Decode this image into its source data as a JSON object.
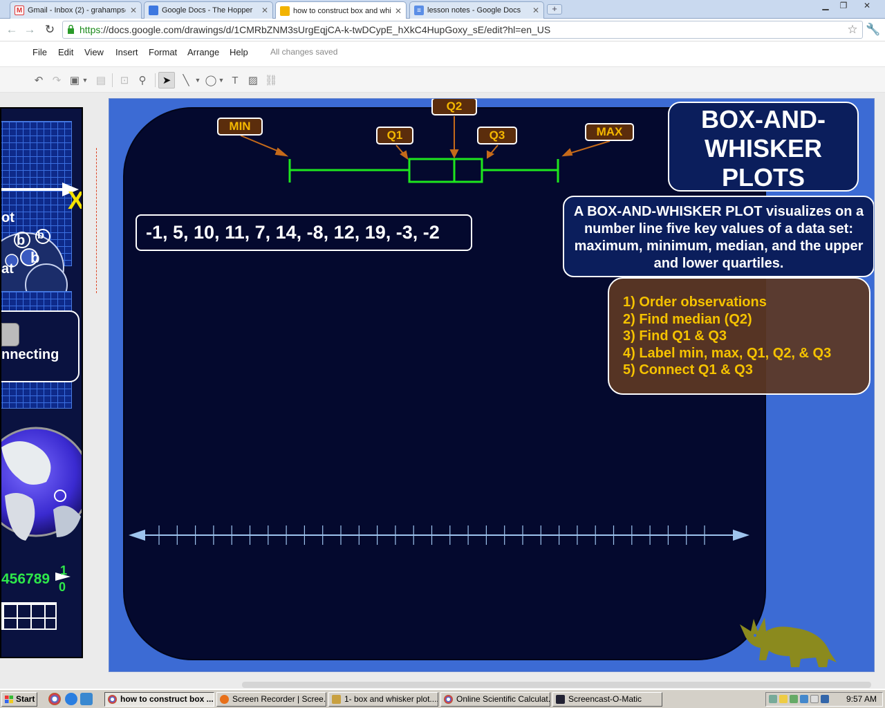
{
  "browser": {
    "tabs": [
      {
        "label": "Gmail - Inbox (2) - grahamps@",
        "favicon": "gmail-icon",
        "active": false
      },
      {
        "label": "Google Docs - The Hopper",
        "favicon": "docs-icon",
        "active": false
      },
      {
        "label": "how to construct box and whis",
        "favicon": "drawings-icon",
        "active": true
      },
      {
        "label": "lesson notes - Google Docs",
        "favicon": "document-icon",
        "active": false
      }
    ],
    "url_scheme": "https",
    "url_rest": "://docs.google.com/drawings/d/1CMRbZNM3sUrgEqjCA-k-twDCypE_hXkC4HupGoxy_sE/edit?hl=en_US"
  },
  "menu": {
    "items": [
      "File",
      "Edit",
      "View",
      "Insert",
      "Format",
      "Arrange",
      "Help"
    ],
    "status": "All changes saved"
  },
  "peek": {
    "x_label": "X",
    "text1": "ot",
    "text2": "at",
    "text3": "e",
    "text4": "nnecting",
    "digits": "456789",
    "digits_tail": "1",
    "digits_tail2": "0",
    "bubble_letter": "b"
  },
  "slide": {
    "title_lines": [
      "BOX-AND-",
      "WHISKER",
      "PLOTS"
    ],
    "definition": "A BOX-AND-WHISKER PLOT visualizes on a number line five key values of a data set: maximum, minimum, median, and the upper and lower quartiles.",
    "steps": [
      "1) Order observations",
      "2) Find median (Q2)",
      "3) Find Q1 & Q3",
      "4) Label min, max, Q1, Q2, & Q3",
      "5) Connect Q1 & Q3"
    ],
    "dataset": "-1, 5, 10, 11, 7, 14, -8, 12, 19, -3, -2",
    "labels": {
      "min": "MIN",
      "q1": "Q1",
      "q2": "Q2",
      "q3": "Q3",
      "max": "MAX"
    },
    "number_line_ticks": 31
  },
  "colors": {
    "slide_bg": "#3c6bd4",
    "panel_bg": "#04092e",
    "box_plot": "#1ee61e",
    "label_bg": "#5b2d0c",
    "label_text": "#f5b800",
    "arrow": "#c56a1a",
    "steps_text": "#f5c200",
    "number_line": "#9ec4ee",
    "dino": "#8b8a1e"
  },
  "taskbar": {
    "start": "Start",
    "items": [
      {
        "label": "how to construct box ...",
        "active": true
      },
      {
        "label": "Screen Recorder | Scree...",
        "active": false
      },
      {
        "label": "1- box and whisker plot....",
        "active": false
      },
      {
        "label": "Online Scientific Calculat...",
        "active": false
      },
      {
        "label": "Screencast-O-Matic",
        "active": false
      }
    ],
    "clock": "9:57 AM"
  }
}
